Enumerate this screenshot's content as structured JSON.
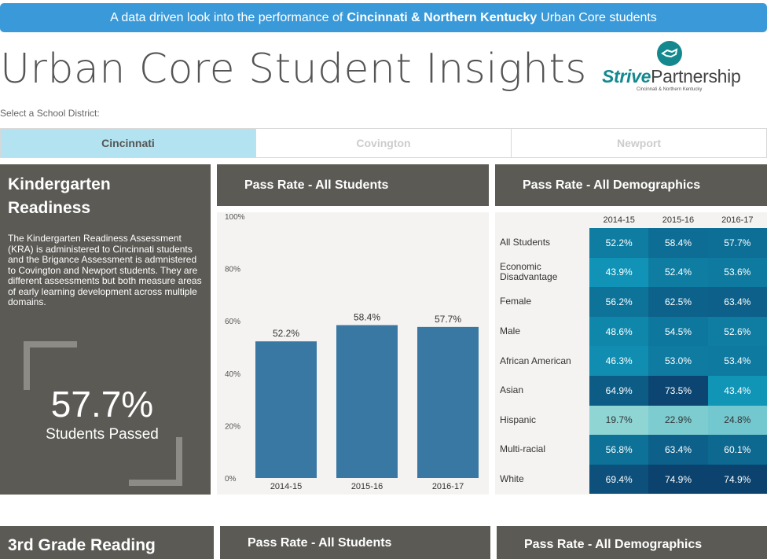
{
  "banner": {
    "prefix": "A data driven look into the performance of",
    "highlight": "Cincinnati & Northern Kentucky",
    "suffix": "Urban Core students"
  },
  "page_title": "Urban Core Student Insights",
  "logo": {
    "strive": "Strive",
    "partnership": "Partnership",
    "subtitle": "Cincinnati & Northern Kentucky",
    "color": "#13898f"
  },
  "select_label": "Select a School District:",
  "districts": [
    {
      "label": "Cincinnati",
      "active": true
    },
    {
      "label": "Covington",
      "active": false
    },
    {
      "label": "Newport",
      "active": false
    }
  ],
  "kindergarten": {
    "title": "Kindergarten Readiness",
    "description": "The Kindergarten Readiness Assessment (KRA) is administered to Cincinnati students and the Brigance Assessment is admnistered to Covington and Newport students.  They are different assessments but both measure areas of early learning development across multiple domains.",
    "big_value": "57.7%",
    "big_label": "Students Passed",
    "pass_rate_header": "Pass Rate - All Students",
    "demographics_header": "Pass Rate - All Demographics"
  },
  "chart_data": {
    "type": "bar",
    "categories": [
      "2014-15",
      "2015-16",
      "2016-17"
    ],
    "values": [
      52.2,
      58.4,
      57.7
    ],
    "value_labels": [
      "52.2%",
      "58.4%",
      "57.7%"
    ],
    "y_ticks": [
      "0%",
      "20%",
      "40%",
      "60%",
      "80%",
      "100%"
    ],
    "ylim": [
      0,
      100
    ],
    "bar_color": "#3a78a4",
    "title": "Pass Rate - All Students"
  },
  "demographics": {
    "years": [
      "2014-15",
      "2015-16",
      "2016-17"
    ],
    "rows": [
      {
        "label": "All Students",
        "values": [
          "52.2%",
          "58.4%",
          "57.7%"
        ]
      },
      {
        "label": "Economic Disadvantage",
        "values": [
          "43.9%",
          "52.4%",
          "53.6%"
        ]
      },
      {
        "label": "Female",
        "values": [
          "56.2%",
          "62.5%",
          "63.4%"
        ]
      },
      {
        "label": "Male",
        "values": [
          "48.6%",
          "54.5%",
          "52.6%"
        ]
      },
      {
        "label": "African American",
        "values": [
          "46.3%",
          "53.0%",
          "53.4%"
        ]
      },
      {
        "label": "Asian",
        "values": [
          "64.9%",
          "73.5%",
          "43.4%"
        ]
      },
      {
        "label": "Hispanic",
        "values": [
          "19.7%",
          "22.9%",
          "24.8%"
        ]
      },
      {
        "label": "Multi-racial",
        "values": [
          "56.8%",
          "63.4%",
          "60.1%"
        ]
      },
      {
        "label": "White",
        "values": [
          "69.4%",
          "74.9%",
          "74.9%"
        ]
      }
    ]
  },
  "third_grade": {
    "title": "3rd Grade Reading",
    "pass_rate_header": "Pass Rate - All Students",
    "demographics_header": "Pass Rate - All Demographics"
  }
}
